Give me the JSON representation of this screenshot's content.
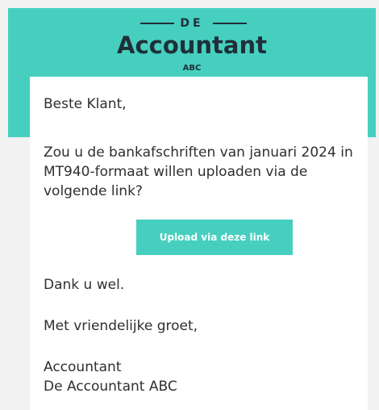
{
  "header": {
    "background_color": "#46cfbf",
    "logo": {
      "top_text": "DE",
      "main_text": "Accountant",
      "sub_text": "ABC"
    }
  },
  "email": {
    "greeting": "Beste Klant,",
    "request_text": "Zou u de bankafschriften van januari 2024 in MT940-formaat willen uploaden via de volgende link?",
    "upload_button_label": "Upload via deze link",
    "thanks": "Dank u wel.",
    "closing": "Met vriendelijke groet,",
    "signature": {
      "line1": "Accountant",
      "line2": "De Accountant ABC"
    },
    "accent_color": "#46cfbf"
  }
}
